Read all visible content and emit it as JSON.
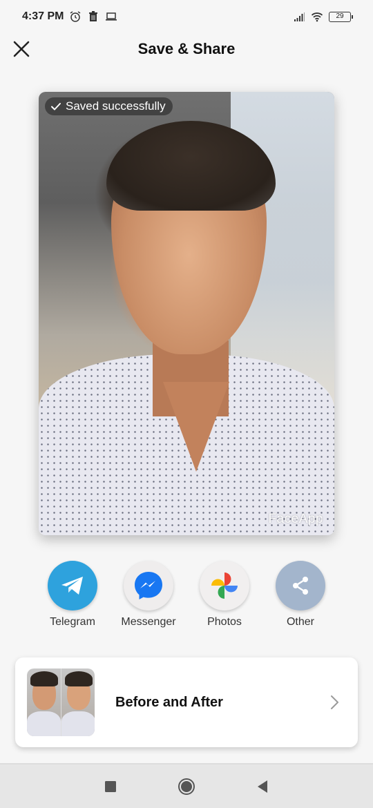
{
  "status_bar": {
    "time": "4:37 PM",
    "left_icons": [
      "alarm-icon",
      "trash-icon",
      "laptop-icon"
    ],
    "right_icons": [
      "signal-icon",
      "wifi-icon",
      "battery-icon"
    ],
    "battery_level": "29"
  },
  "app_bar": {
    "title": "Save & Share",
    "close_icon": "close-icon"
  },
  "photo": {
    "saved_message": "Saved successfully",
    "saved_icon": "check-icon",
    "watermark": "FaceApp"
  },
  "share_targets": [
    {
      "label": "Telegram",
      "icon": "telegram-icon",
      "color": "#2ea2dd"
    },
    {
      "label": "Messenger",
      "icon": "messenger-icon",
      "color": "#1877f2"
    },
    {
      "label": "Photos",
      "icon": "google-photos-icon",
      "color": "#f1efef"
    },
    {
      "label": "Other",
      "icon": "share-icon",
      "color": "#a3b5cc"
    }
  ],
  "before_after": {
    "label": "Before and After",
    "chevron": "chevron-right-icon"
  },
  "nav_bar": {
    "buttons": [
      "recents-icon",
      "home-icon",
      "back-icon"
    ]
  }
}
